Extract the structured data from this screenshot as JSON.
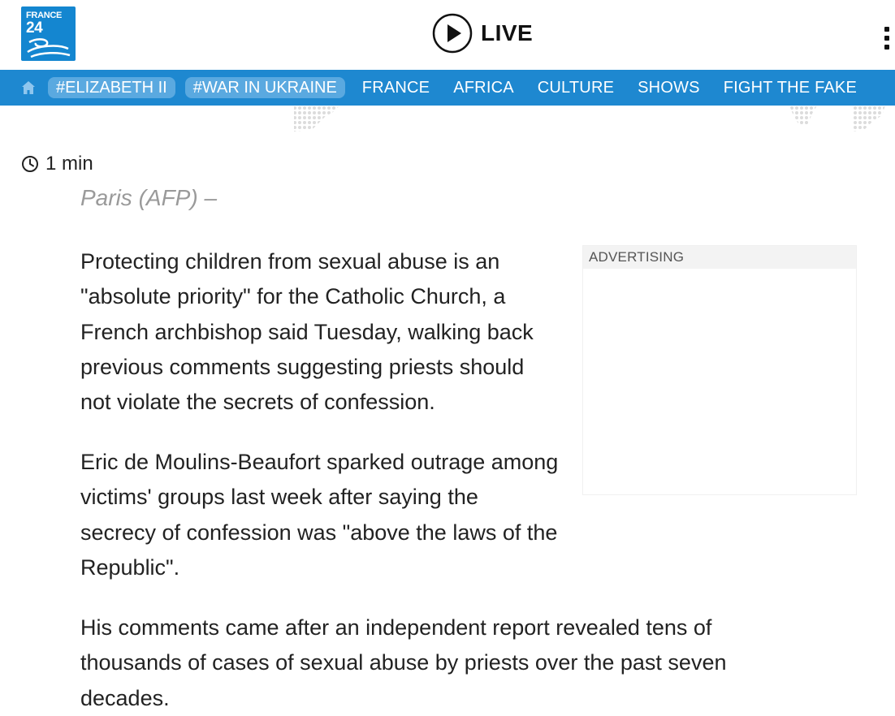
{
  "header": {
    "logo": {
      "line1": "FRANCE",
      "line2": "24",
      "brand_color": "#1486d0"
    },
    "live_label": "LIVE",
    "menu_icon": "vertical-ellipsis-icon"
  },
  "nav": {
    "home_icon": "home-icon",
    "background": "#1e88d0",
    "tags": [
      "#ELIZABETH II",
      "#WAR IN UKRAINE"
    ],
    "items": [
      "FRANCE",
      "AFRICA",
      "CULTURE",
      "SHOWS",
      "FIGHT THE FAKE"
    ]
  },
  "article": {
    "read_time": "1 min",
    "read_time_icon": "clock-icon",
    "dateline": "Paris (AFP) –",
    "paragraphs": [
      "Protecting children from sexual abuse is an \"absolute priority\" for the Catholic Church, a French archbishop said Tuesday, walking back previous comments suggesting priests should not violate the secrets of confession.",
      "Eric de Moulins-Beaufort sparked outrage among victims' groups last week after saying the secrecy of confession was \"above the laws of the Republic\".",
      "His comments came after an independent report revealed tens of thousands of cases of sexual abuse by priests over the past seven decades."
    ]
  },
  "ad": {
    "label": "ADVERTISING"
  }
}
